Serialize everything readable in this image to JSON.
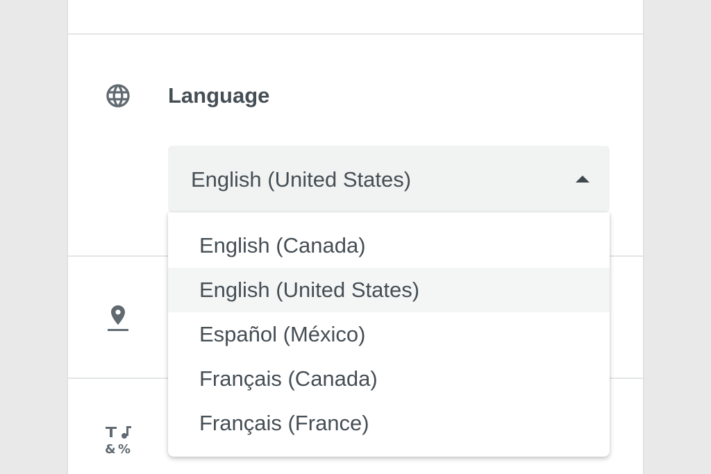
{
  "language_section": {
    "title": "Language",
    "icon": "globe-icon"
  },
  "language_select": {
    "value": "English (United States)",
    "expanded": true,
    "options": [
      {
        "label": "English (Canada)",
        "selected": false
      },
      {
        "label": "English (United States)",
        "selected": true
      },
      {
        "label": "Español (México)",
        "selected": false
      },
      {
        "label": "Français (Canada)",
        "selected": false
      },
      {
        "label": "Français (France)",
        "selected": false
      }
    ]
  },
  "other_sections": [
    {
      "icon": "location-pin-icon"
    },
    {
      "icon": "text-format-icon"
    }
  ],
  "colors": {
    "background": "#e9e9e9",
    "panel": "#ffffff",
    "text": "#454e54",
    "icon": "#606a70",
    "select_background": "#f1f3f2",
    "selected_option": "#f4f6f5"
  }
}
